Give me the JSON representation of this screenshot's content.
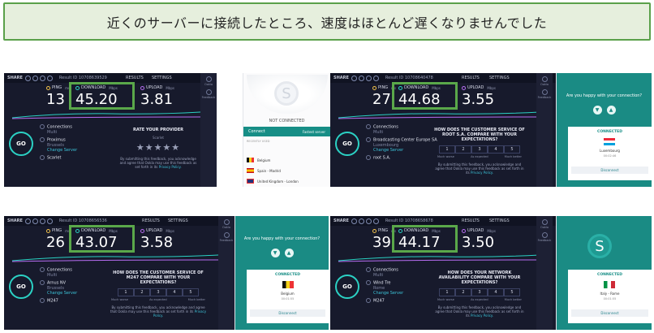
{
  "banner": {
    "text": "近くのサーバーに接続したところ、速度はほとんど遅くなりませんでした"
  },
  "common": {
    "share": "SHARE",
    "results": "RESULTS",
    "settings": "SETTINGS",
    "ping_label": "PING",
    "ping_unit": "ms",
    "download_label": "DOWNLOAD",
    "download_unit": "Mbps",
    "upload_label": "UPLOAD",
    "upload_unit": "Mbps",
    "go": "GO",
    "connections": "Connections",
    "multi": "Multi",
    "change_server": "Change Server",
    "side_results": "Ookla",
    "side_other": "Feedback",
    "scale_low": "Much worse",
    "scale_mid": "As expected",
    "scale_high": "Much better",
    "disclaimer_a": "By submitting this feedback, you acknowledge and agree that Ookla may use this feedback",
    "disclaimer_b": "as set forth in its",
    "privacy": "Privacy Policy."
  },
  "panels": [
    {
      "result_id": "10708639529",
      "ping": "13",
      "download": "45.20",
      "upload": "3.81",
      "isp": "Proximus",
      "isp_city": "Brussels",
      "server": "Scarlet",
      "server_sub": "·",
      "question": "RATE YOUR PROVIDER",
      "question_sub": "Scarlet",
      "stars": "★★★★★"
    },
    {
      "result_id": "10708640478",
      "ping": "27",
      "download": "44.68",
      "upload": "3.55",
      "isp": "Broadcasting Center Europe SA",
      "isp_city": "Luxembourg",
      "server": "root S.A.",
      "server_sub": "·",
      "question": "HOW DOES THE CUSTOMER SERVICE OF ROOT S.A. COMPARE WITH YOUR EXPECTATIONS?",
      "nums": [
        "1",
        "2",
        "3",
        "4",
        "5"
      ]
    },
    {
      "result_id": "10708656536",
      "ping": "26",
      "download": "43.07",
      "upload": "3.58",
      "isp": "Arnus NV",
      "isp_city": "Brussels",
      "server": "M247",
      "server_sub": "·",
      "question": "HOW DOES THE CUSTOMER SERVICE OF M247 COMPARE WITH YOUR EXPECTATIONS?",
      "nums": [
        "1",
        "2",
        "3",
        "4",
        "5"
      ]
    },
    {
      "result_id": "10708658678",
      "ping": "39",
      "download": "44.17",
      "upload": "3.50",
      "isp": "Wind Tre",
      "isp_city": "Rome",
      "server": "M247",
      "server_sub": "·",
      "question": "HOW DOES YOUR NETWORK AVAILABILITY COMPARE WITH YOUR EXPECTATIONS?",
      "nums": [
        "1",
        "2",
        "3",
        "4",
        "5"
      ]
    }
  ],
  "vpn_disconnected": {
    "status": "NOT CONNECTED",
    "connect": "Connect",
    "fastest": "Fastest server",
    "recent": "RECENTLY USED",
    "locations": [
      "Belgium",
      "Spain - Madrid",
      "United Kingdom - London"
    ]
  },
  "vpn_connected": [
    {
      "ask": "Are you happy with your connection?",
      "status": "CONNECTED",
      "country": "Luxembourg",
      "time": "00:02:46",
      "disconnect": "Disconnect"
    },
    {
      "ask": "Are you happy with your connection?",
      "status": "CONNECTED",
      "country": "Belgium",
      "time": "00:01:55",
      "disconnect": "Disconnect"
    },
    {
      "ask": "Are you happy with your connection?",
      "status": "CONNECTED",
      "country": "Italy - Rome",
      "time": "00:01:55",
      "disconnect": "Disconnect"
    }
  ],
  "colors": {
    "highlight": "#5aa84a",
    "banner_bg": "#e6efdd",
    "app_bg": "#171a2c",
    "surfshark": "#1a8b84"
  }
}
